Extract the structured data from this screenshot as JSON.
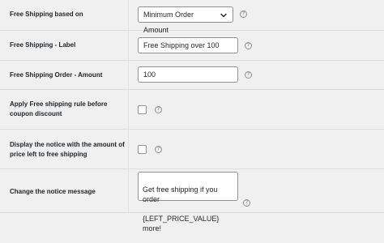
{
  "settings": {
    "free_shipping_based_on": {
      "label": "Free Shipping based on",
      "value": "Minimum Order Amount",
      "help": "?"
    },
    "free_shipping_label": {
      "label": "Free Shipping - Label",
      "value": "Free Shipping over 100",
      "help": "?"
    },
    "free_shipping_order_amount": {
      "label": "Free Shipping Order - Amount",
      "value": "100",
      "help": "?"
    },
    "apply_rule_before_coupon": {
      "label_line1": "Apply Free shipping rule before",
      "label_line2": "coupon discount",
      "checked": false,
      "help": "?"
    },
    "display_notice": {
      "label_line1": "Display the notice with the amount of",
      "label_line2": "price left to free shipping",
      "checked": false,
      "help": "?"
    },
    "notice_message": {
      "label": "Change the notice message",
      "value_line1": "Get free shipping if you order",
      "value_line2": "{LEFT_PRICE_VALUE} more!",
      "help": "?"
    }
  }
}
